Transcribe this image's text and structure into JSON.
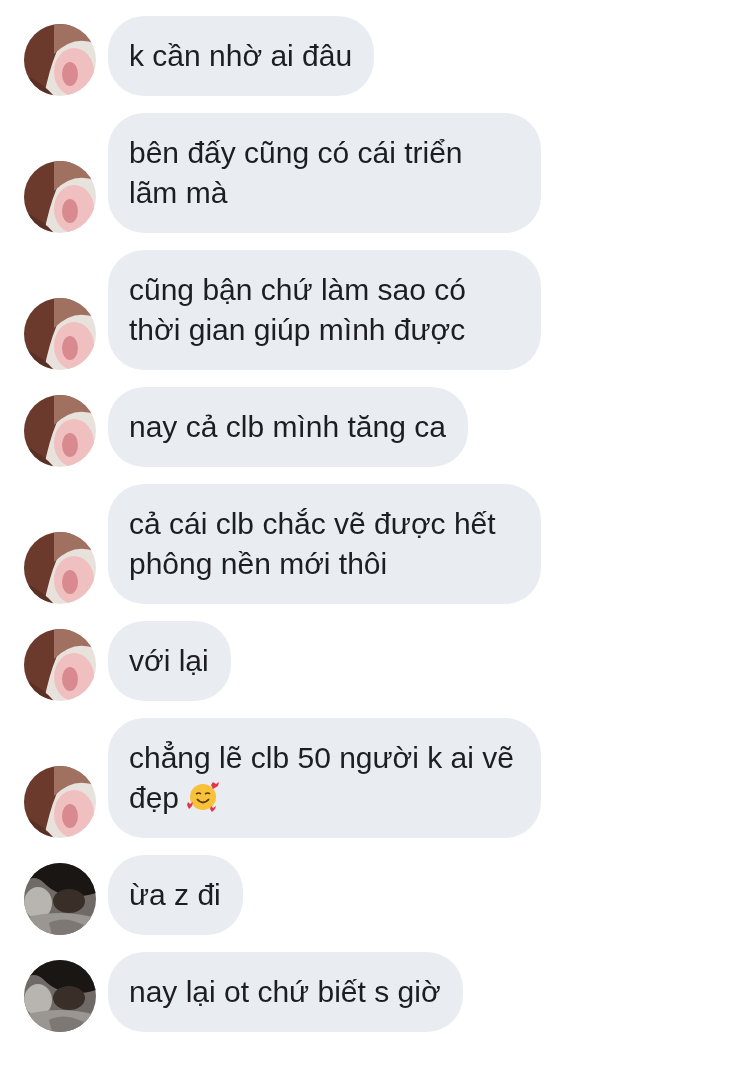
{
  "messages": [
    {
      "text": "k cần nhờ ai đâu",
      "kind": "first"
    },
    {
      "text": "bên đấy cũng có cái triển lãm mà",
      "kind": "first"
    },
    {
      "text": "cũng bận chứ làm sao có thời gian giúp mình được",
      "kind": "first"
    },
    {
      "text": "nay cả clb mình tăng ca",
      "kind": "first"
    },
    {
      "text": "cả cái clb chắc vẽ được hết phông nền mới thôi",
      "kind": "first"
    },
    {
      "text": "với lại",
      "kind": "first"
    },
    {
      "text": "chẳng lẽ clb 50 người k ai vẽ đẹp",
      "kind": "first",
      "trailing_icon": {
        "kind": "smile-hearts"
      }
    },
    {
      "text": "ừa z đi",
      "kind": "second"
    },
    {
      "text": "nay lại ot chứ biết s giờ",
      "kind": "second"
    }
  ]
}
